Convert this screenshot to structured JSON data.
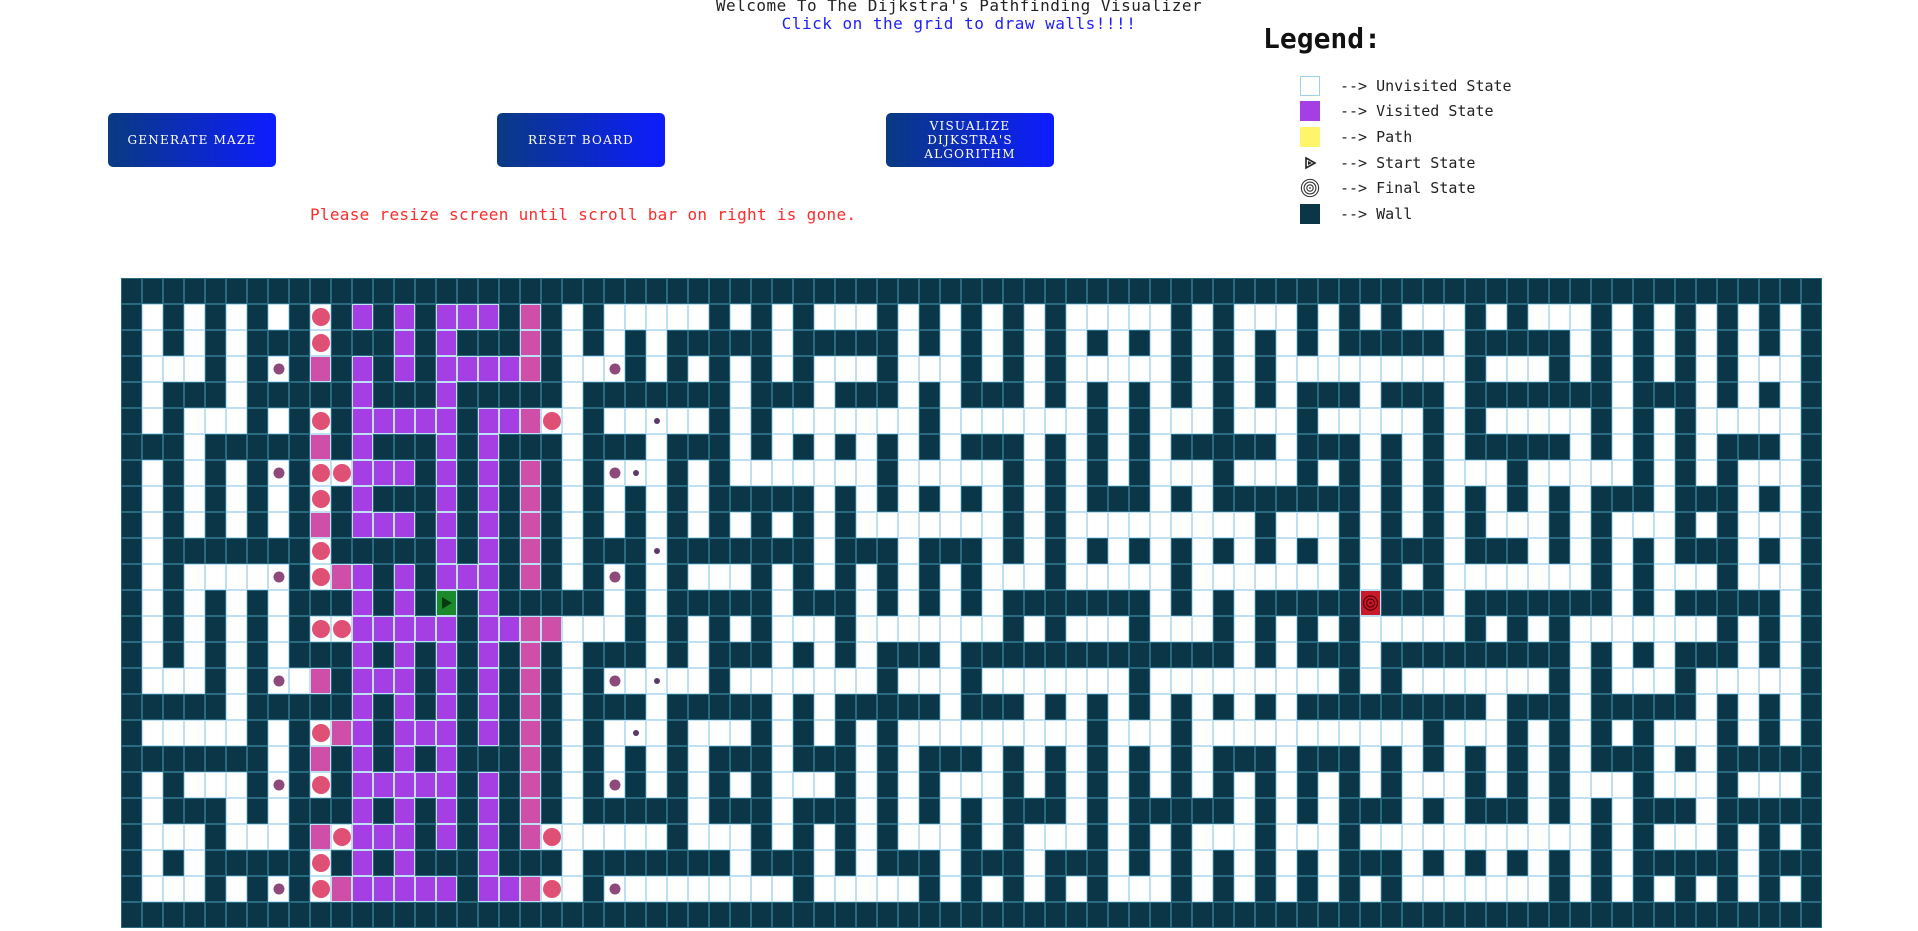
{
  "header": {
    "title": "Welcome To The Dijkstra's Pathfinding Visualizer",
    "subtitle": "Click on the grid to draw walls!!!!"
  },
  "buttons": {
    "generate_maze": "GENERATE MAZE",
    "reset_board": "RESET BOARD",
    "visualize": "VISUALIZE DIJKSTRA'S ALGORITHM"
  },
  "warning": "Please resize screen until scroll bar on right is gone.",
  "legend": {
    "title": "Legend:",
    "items": [
      {
        "label": "--> Unvisited State",
        "icon": "unvisited-swatch"
      },
      {
        "label": "--> Visited State",
        "icon": "visited-swatch",
        "color": "#a63fe3"
      },
      {
        "label": "--> Path",
        "icon": "path-swatch",
        "color": "#fff56a"
      },
      {
        "label": "--> Start State",
        "icon": "play-triangle-icon"
      },
      {
        "label": "--> Final State",
        "icon": "target-rings-icon"
      },
      {
        "label": "--> Wall",
        "icon": "wall-swatch",
        "color": "#0b3648"
      }
    ]
  },
  "grid": {
    "rows": 25,
    "cols": 81,
    "start": {
      "row": 12,
      "col": 15
    },
    "finish": {
      "row": 12,
      "col": 59
    },
    "colors": {
      "wall": "#0b3648",
      "unvisited": "#ffffff",
      "visited": "#a63fe3",
      "frontier": "#e0527a",
      "start": "#1a8a2a",
      "finish": "#c81a2a"
    }
  }
}
